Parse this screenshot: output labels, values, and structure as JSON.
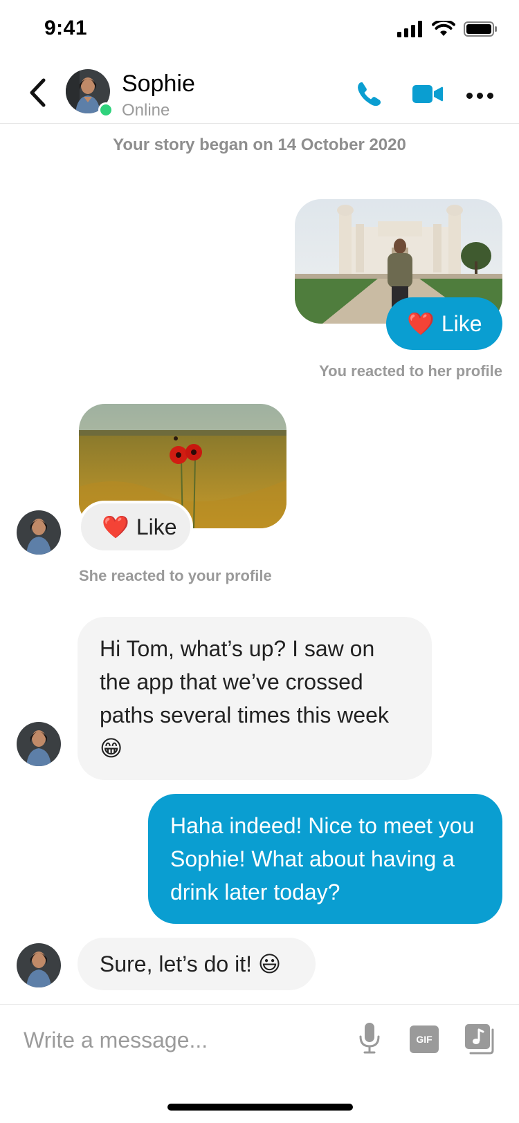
{
  "status_bar": {
    "time": "9:41"
  },
  "header": {
    "name": "Sophie",
    "status": "Online"
  },
  "story_began": "Your story began on 14 October 2020",
  "reactions": {
    "outgoing_like": "Like",
    "outgoing_caption": "You reacted to her profile",
    "incoming_like": "Like",
    "incoming_caption": "She reacted to your profile",
    "heart_emoji": "❤️"
  },
  "messages": [
    {
      "direction": "incoming",
      "text": "Hi Tom, what’s up? I saw on the app that we’ve crossed paths several times this week 😁"
    },
    {
      "direction": "outgoing",
      "text": "Haha indeed! Nice to meet you Sophie! What about having a drink later today?"
    },
    {
      "direction": "incoming",
      "text": "Sure, let’s do it! 😃"
    }
  ],
  "composer": {
    "placeholder": "Write a message...",
    "gif_label": "GIF"
  },
  "colors": {
    "accent": "#0a9ed1",
    "online": "#2fd27c",
    "incoming_bubble": "#f4f4f4",
    "muted_text": "#9a9a9a"
  },
  "icons": [
    "back-chevron-icon",
    "phone-icon",
    "video-camera-icon",
    "more-dots-icon",
    "microphone-icon",
    "gif-icon",
    "media-library-icon",
    "signal-icon",
    "wifi-icon",
    "battery-icon"
  ]
}
